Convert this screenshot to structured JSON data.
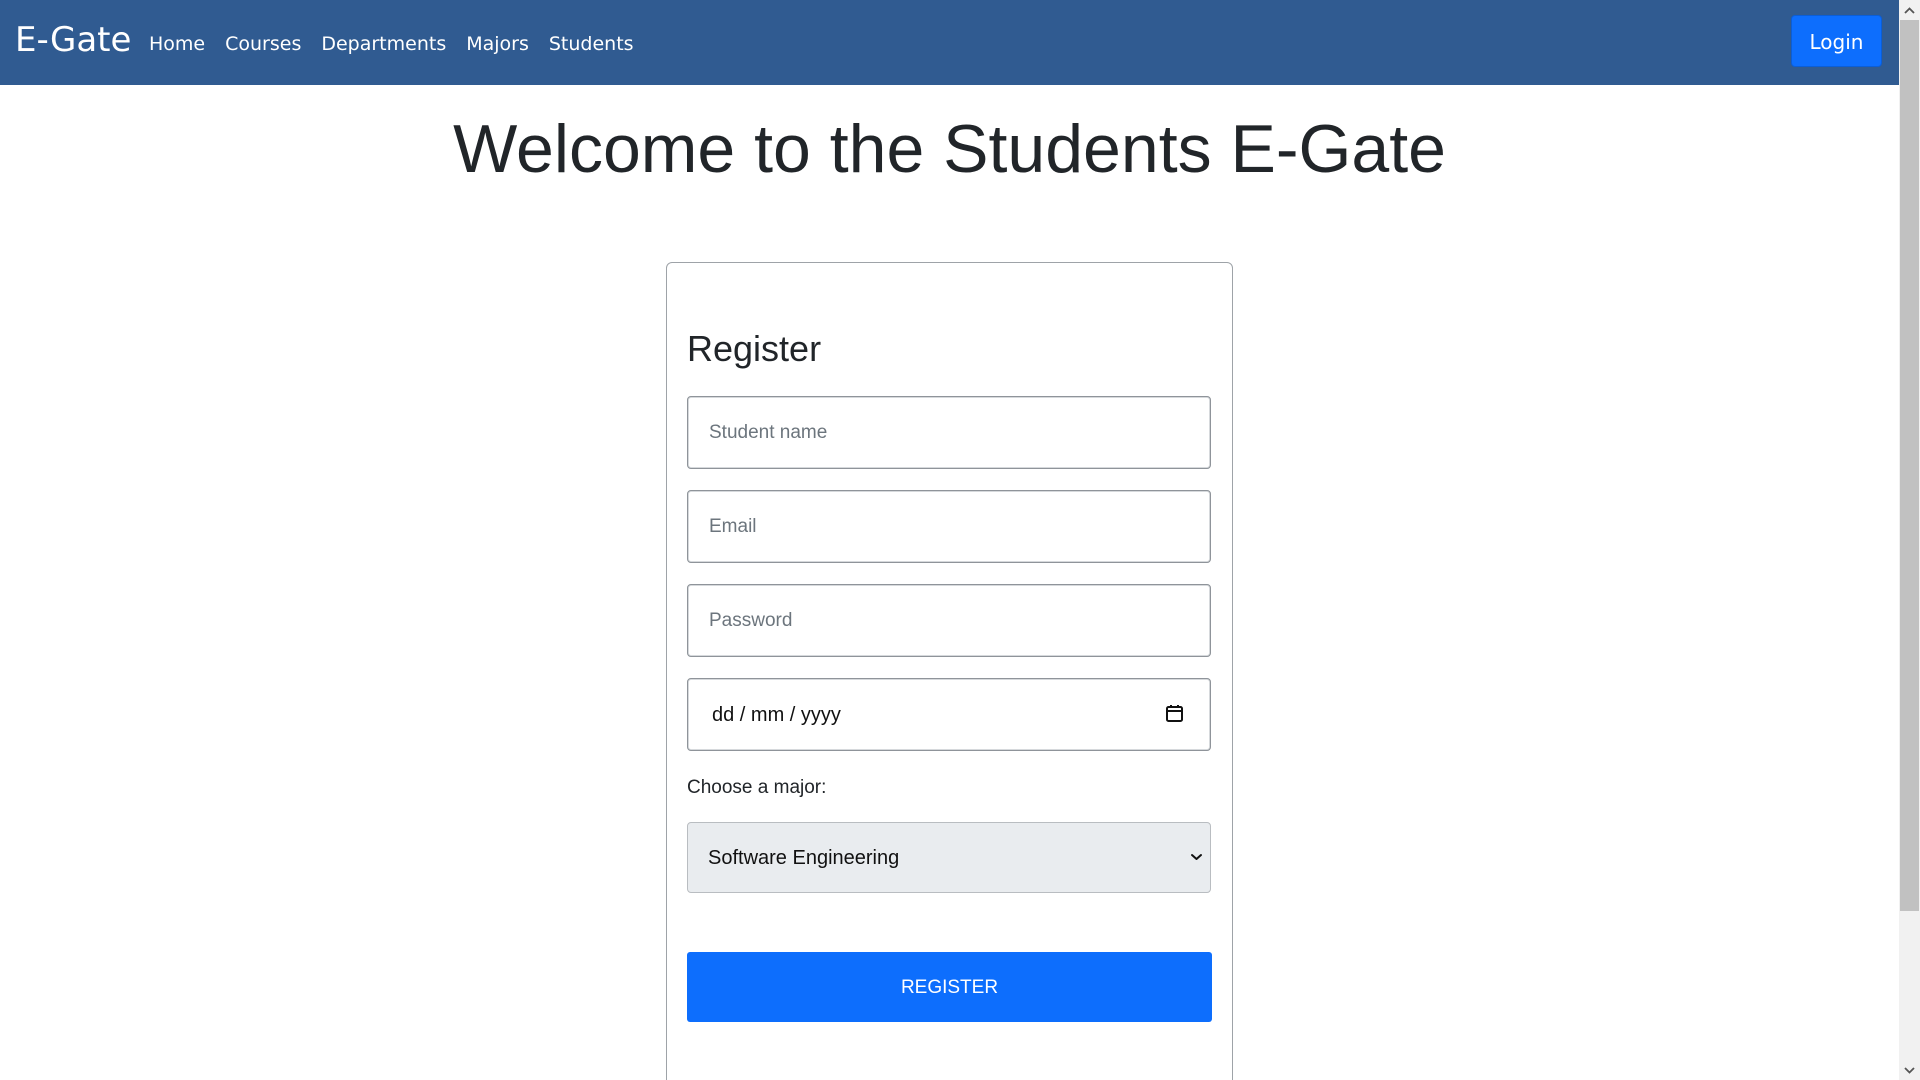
{
  "header": {
    "brand": "E-Gate",
    "nav_items": [
      {
        "label": "Home"
      },
      {
        "label": "Courses"
      },
      {
        "label": "Departments"
      },
      {
        "label": "Majors"
      },
      {
        "label": "Students"
      }
    ],
    "login_label": "Login"
  },
  "main": {
    "title": "Welcome to the Students E-Gate"
  },
  "register_form": {
    "title": "Register",
    "student_name_placeholder": "Student name",
    "email_placeholder": "Email",
    "password_placeholder": "Password",
    "date_placeholder": "dd / mm / yyyy",
    "major_label": "Choose a major:",
    "major_selected": "Software Engineering",
    "submit_label": "REGISTER"
  },
  "icons": {
    "calendar": "calendar-icon",
    "select_arrow": "chevron-down-icon",
    "scroll_up": "chevron-up-icon",
    "scroll_down": "chevron-down-icon"
  },
  "colors": {
    "navbar": "#305b91",
    "primary": "#0d6efd",
    "text": "#212529",
    "select_background": "#e9ecef"
  }
}
